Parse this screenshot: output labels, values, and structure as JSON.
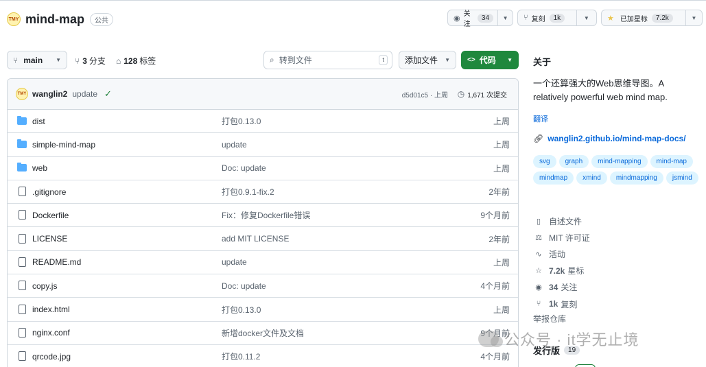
{
  "repo": {
    "avatar_text": "TMY",
    "name": "mind-map",
    "visibility": "公共"
  },
  "header_actions": {
    "watch": {
      "label": "关注",
      "count": "34"
    },
    "fork": {
      "label": "复刻",
      "count": "1k"
    },
    "star": {
      "label": "已加星标",
      "count": "7.2k"
    }
  },
  "toolbar": {
    "branch": "main",
    "branches": {
      "count": "3",
      "label": "分支"
    },
    "tags": {
      "count": "128",
      "label": "标签"
    },
    "search_placeholder": "转到文件",
    "search_kbd": "t",
    "add_file": "添加文件",
    "code": "代码"
  },
  "last_commit": {
    "author": "wanglin2",
    "message": "update",
    "hash": "d5d01c5 · 上周",
    "commits": "1,671 次提交"
  },
  "files": [
    {
      "type": "folder",
      "name": "dist",
      "message": "打包0.13.0",
      "age": "上周"
    },
    {
      "type": "folder",
      "name": "simple-mind-map",
      "message": "update",
      "age": "上周"
    },
    {
      "type": "folder",
      "name": "web",
      "message": "Doc: update",
      "age": "上周"
    },
    {
      "type": "file",
      "name": ".gitignore",
      "message": "打包0.9.1-fix.2",
      "age": "2年前"
    },
    {
      "type": "file",
      "name": "Dockerfile",
      "message": "Fix：修复Dockerfile错误",
      "age": "9个月前"
    },
    {
      "type": "file",
      "name": "LICENSE",
      "message": "add MIT LICENSE",
      "age": "2年前"
    },
    {
      "type": "file",
      "name": "README.md",
      "message": "update",
      "age": "上周"
    },
    {
      "type": "file",
      "name": "copy.js",
      "message": "Doc: update",
      "age": "4个月前"
    },
    {
      "type": "file",
      "name": "index.html",
      "message": "打包0.13.0",
      "age": "上周"
    },
    {
      "type": "file",
      "name": "nginx.conf",
      "message": "新增docker文件及文档",
      "age": "9个月前"
    },
    {
      "type": "file",
      "name": "qrcode.jpg",
      "message": "打包0.11.2",
      "age": "4个月前"
    }
  ],
  "about": {
    "title": "关于",
    "description": "一个还算强大的Web思维导图。A relatively powerful web mind map.",
    "translate": "翻译",
    "homepage": "wanglin2.github.io/mind-map-docs/",
    "topics": [
      "svg",
      "graph",
      "mind-mapping",
      "mind-map",
      "mindmap",
      "xmind",
      "mindmapping",
      "jsmind"
    ],
    "readme": "自述文件",
    "license": "MIT 许可证",
    "activity": "活动",
    "stars": {
      "count": "7.2k",
      "label": "星标"
    },
    "watchers": {
      "count": "34",
      "label": "关注"
    },
    "forks": {
      "count": "1k",
      "label": "复刻"
    },
    "report": "举报仓库"
  },
  "releases": {
    "title": "发行版",
    "count": "19"
  },
  "watermark": "公众号 · it学无止境",
  "colors": {
    "accent": "#0969da",
    "code_button": "#1f883d",
    "folder": "#54aeff",
    "topic_bg": "#ddf4ff"
  }
}
